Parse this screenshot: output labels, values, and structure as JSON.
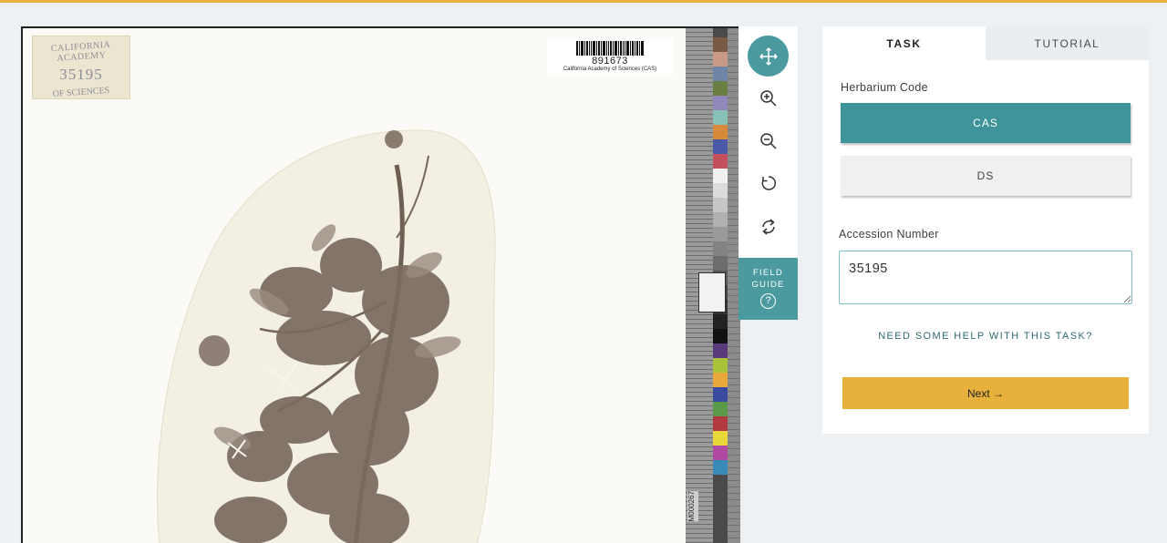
{
  "subject": {
    "stamp_lines": [
      "CALIFORNIA ACADEMY",
      "35195",
      "OF SCIENCES"
    ],
    "barcode_number": "891673",
    "barcode_caption": "California Academy of Sciences (CAS)",
    "ruler_tag": "M000267"
  },
  "toolbar": {
    "tools": [
      {
        "name": "move-icon",
        "active": true
      },
      {
        "name": "zoom-in-icon",
        "active": false
      },
      {
        "name": "zoom-out-icon",
        "active": false
      },
      {
        "name": "rotate-icon",
        "active": false
      },
      {
        "name": "reset-icon",
        "active": false
      }
    ],
    "field_guide_line1": "FIELD",
    "field_guide_line2": "GUIDE",
    "field_guide_icon": "?"
  },
  "panel": {
    "tabs": [
      {
        "label": "TASK",
        "active": true
      },
      {
        "label": "TUTORIAL",
        "active": false
      }
    ],
    "herbarium_label": "Herbarium Code",
    "choices": [
      {
        "label": "CAS",
        "selected": true
      },
      {
        "label": "DS",
        "selected": false
      }
    ],
    "accession_label": "Accession Number",
    "accession_value": "35195",
    "help_link": "NEED SOME HELP WITH THIS TASK?",
    "next_label": "Next →"
  },
  "colors": {
    "accent_teal": "#4a9a9f",
    "accent_yellow": "#e8b13b",
    "background": "#eef1f4"
  }
}
